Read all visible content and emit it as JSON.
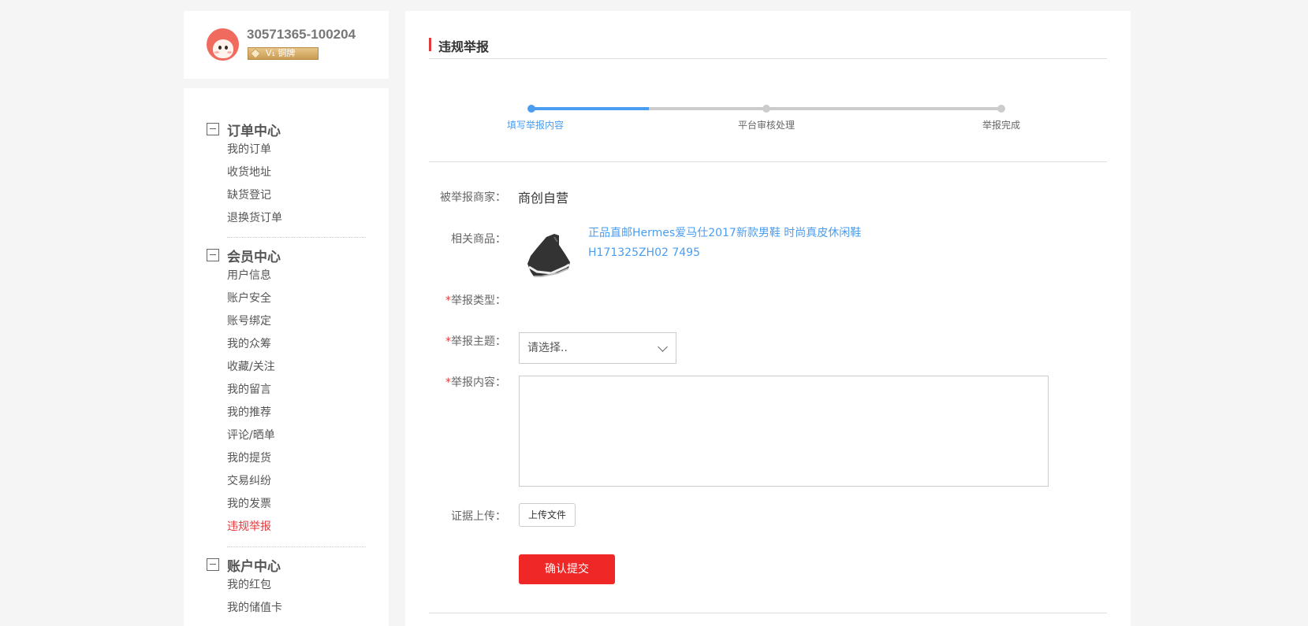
{
  "user": {
    "name": "30571365-100204",
    "level": "V₁ 铜牌"
  },
  "sidebar": {
    "groups": [
      {
        "title": "订单中心",
        "items": [
          "我的订单",
          "收货地址",
          "缺货登记",
          "退换货订单"
        ]
      },
      {
        "title": "会员中心",
        "items": [
          "用户信息",
          "账户安全",
          "账号绑定",
          "我的众筹",
          "收藏/关注",
          "我的留言",
          "我的推荐",
          "评论/晒单",
          "我的提货",
          "交易纠纷",
          "我的发票",
          "违规举报"
        ]
      },
      {
        "title": "账户中心",
        "items": [
          "我的红包",
          "我的储值卡"
        ]
      }
    ],
    "active_item": "违规举报"
  },
  "main": {
    "title": "违规举报",
    "steps": {
      "labels": [
        "填写举报内容",
        "平台审核处理",
        "举报完成"
      ],
      "current": 1,
      "progress": 0.25
    },
    "form": {
      "merchant_label": "被举报商家：",
      "merchant_value": "商创自营",
      "product_label": "相关商品：",
      "product_name_line1": "正品直邮Hermes爱马仕2017新款男鞋 时尚真皮休闲鞋",
      "product_name_line2": "H171325ZH02 7495",
      "type_label": "举报类型：",
      "subject_label": "举报主题：",
      "subject_placeholder": "请选择..",
      "content_label": "举报内容：",
      "evidence_label": "证据上传：",
      "upload_button": "上传文件",
      "submit_button": "确认提交",
      "required_mark": "*"
    }
  },
  "colors": {
    "accent_red": "#e4393c",
    "submit_red": "#f02727",
    "link_blue": "#4a9df0"
  }
}
